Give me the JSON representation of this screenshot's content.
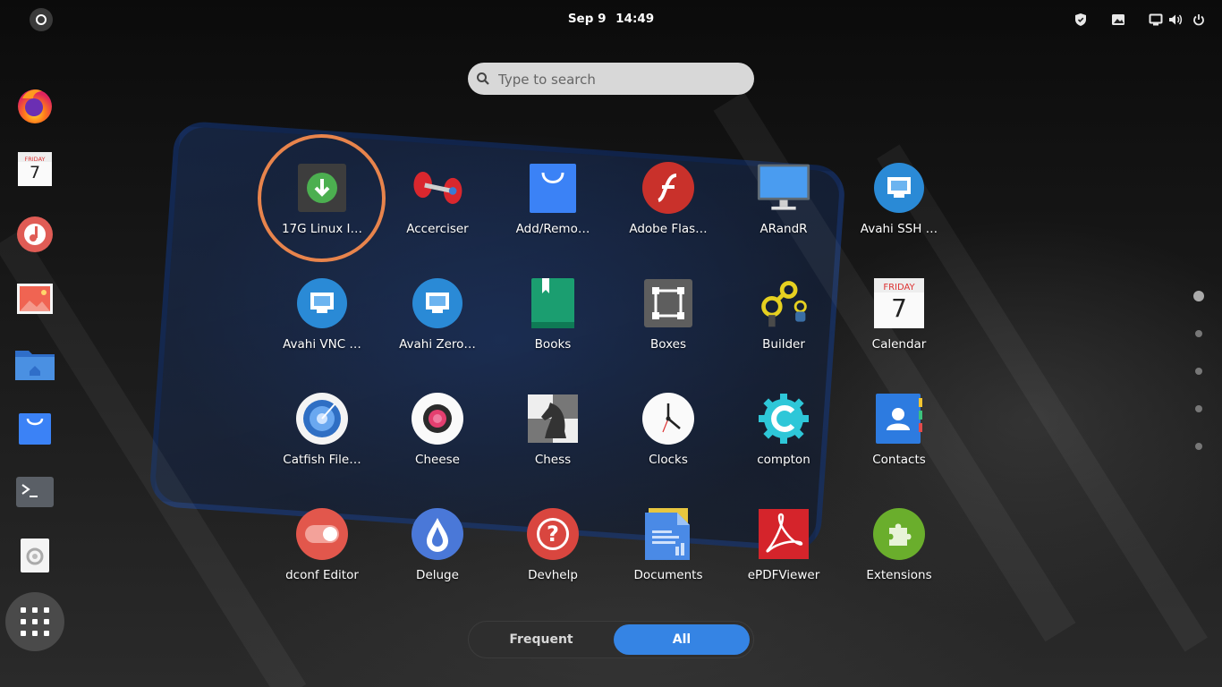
{
  "topbar": {
    "date": "Sep 9",
    "time": "14:49",
    "tray_icons": [
      "shield-icon",
      "screenshot-icon",
      "display-icon",
      "volume-icon",
      "power-icon"
    ]
  },
  "search": {
    "placeholder": "Type to search"
  },
  "dock": {
    "items": [
      {
        "name": "firefox",
        "icon": "firefox-icon"
      },
      {
        "name": "calendar",
        "icon": "calendar-icon",
        "weekday": "FRIDAY",
        "day": "7"
      },
      {
        "name": "music",
        "icon": "music-icon"
      },
      {
        "name": "image-viewer",
        "icon": "image-icon"
      },
      {
        "name": "files",
        "icon": "folder-icon"
      },
      {
        "name": "software",
        "icon": "shopping-bag-icon"
      },
      {
        "name": "terminal",
        "icon": "terminal-icon"
      },
      {
        "name": "trash",
        "icon": "trash-icon"
      }
    ],
    "show_apps": "grid-icon"
  },
  "apps": [
    {
      "label": "17G Linux I…",
      "icon": "download-icon"
    },
    {
      "label": "Accerciser",
      "icon": "accerciser-icon"
    },
    {
      "label": "Add/Remo…",
      "icon": "shopping-bag-icon"
    },
    {
      "label": "Adobe Flas…",
      "icon": "flash-icon"
    },
    {
      "label": "ARandR",
      "icon": "monitor-icon"
    },
    {
      "label": "Avahi SSH …",
      "icon": "network-icon"
    },
    {
      "label": "Avahi VNC …",
      "icon": "network-icon"
    },
    {
      "label": "Avahi Zero…",
      "icon": "network-icon"
    },
    {
      "label": "Books",
      "icon": "book-icon"
    },
    {
      "label": "Boxes",
      "icon": "boxes-icon"
    },
    {
      "label": "Builder",
      "icon": "builder-icon"
    },
    {
      "label": "Calendar",
      "icon": "calendar-icon",
      "weekday": "FRIDAY",
      "day": "7"
    },
    {
      "label": "Catfish File…",
      "icon": "catfish-icon"
    },
    {
      "label": "Cheese",
      "icon": "cheese-icon"
    },
    {
      "label": "Chess",
      "icon": "chess-knight-icon"
    },
    {
      "label": "Clocks",
      "icon": "clock-icon"
    },
    {
      "label": "compton",
      "icon": "gear-icon"
    },
    {
      "label": "Contacts",
      "icon": "contacts-icon"
    },
    {
      "label": "dconf Editor",
      "icon": "toggle-icon"
    },
    {
      "label": "Deluge",
      "icon": "deluge-icon"
    },
    {
      "label": "Devhelp",
      "icon": "help-icon"
    },
    {
      "label": "Documents",
      "icon": "document-icon"
    },
    {
      "label": "ePDFViewer",
      "icon": "pdf-icon"
    },
    {
      "label": "Extensions",
      "icon": "puzzle-icon"
    }
  ],
  "pages": {
    "count": 5,
    "current": 1
  },
  "view_switch": {
    "frequent": "Frequent",
    "all": "All",
    "selected": "all"
  },
  "colors": {
    "accent": "#3584e4",
    "highlight_ring": "#e8844c"
  }
}
